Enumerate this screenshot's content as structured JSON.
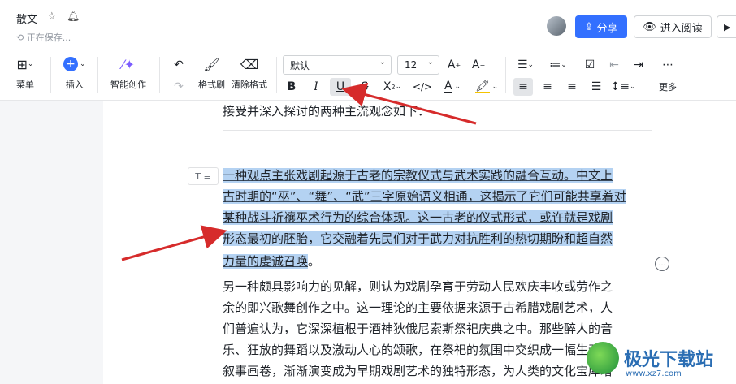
{
  "header": {
    "doc_title": "散文",
    "saving_status": "正在保存...",
    "share_label": "分享",
    "read_mode_label": "进入阅读"
  },
  "toolbar": {
    "menu_label": "菜单",
    "insert_label": "插入",
    "ai_label": "智能创作",
    "format_painter_label": "格式刷",
    "clear_format_label": "清除格式",
    "font_family": "默认",
    "font_size": "12",
    "more_label": "更多"
  },
  "document": {
    "intro_line": "接受并深入探讨的两种主流观念如下：",
    "block_tag": "T ≡",
    "selected_lines": [
      "一种观点主张戏剧起源于古老的宗教仪式与武术实践的融合互动。中文上",
      "古时期的“巫”、“舞”、“武”三字原始语义相通，这揭示了它们可能共享着对",
      "某种战斗祈禳巫术行为的综合体现。这一古老的仪式形式，或许就是戏剧",
      "形态最初的胚胎，它交融着先民们对于武力对抗胜利的热切期盼和超自然",
      "力量的虔诚召唤"
    ],
    "selected_tail": "。",
    "other_lines": [
      "另一种颇具影响力的见解，则认为戏剧孕育于劳动人民欢庆丰收或劳作之",
      "余的即兴歌舞创作之中。这一理论的主要依据来源于古希腊戏剧艺术，人",
      "们普遍认为，它深深植根于酒神狄俄尼索斯祭祀庆典之中。那些醉人的音",
      "乐、狂放的舞蹈以及激动人心的颂歌，在祭祀的氛围中交织成一幅生动的",
      "叙事画卷，渐渐演变成为早期戏剧艺术的独特形态，为人类的文化宝库增"
    ]
  },
  "watermark": {
    "text": "极光下载站",
    "url": "www.xz7.com"
  },
  "colors": {
    "accent": "#3370ff",
    "selection": "#b4d2f2",
    "arrow": "#d62b2b"
  }
}
